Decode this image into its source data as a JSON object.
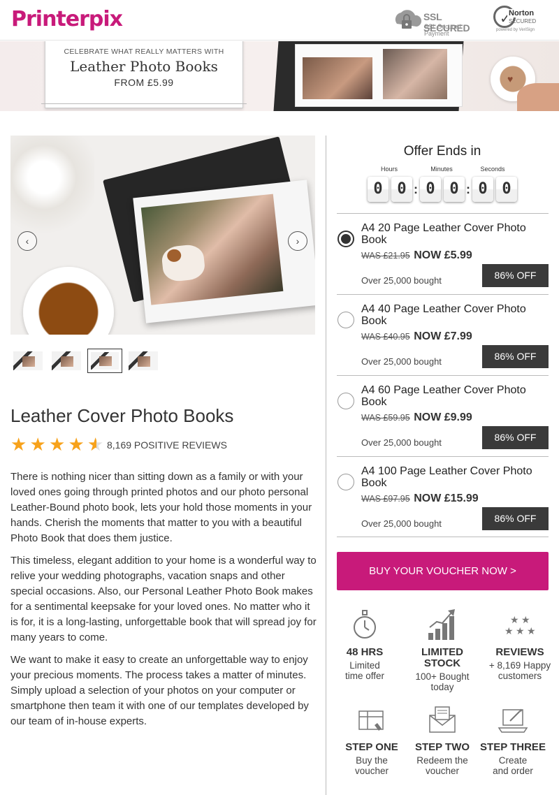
{
  "header": {
    "logo_part1": "Printer",
    "logo_part2": "pix",
    "ssl_title": "SSL SECURED",
    "ssl_subtitle": "SSL Secured Payment",
    "norton_name": "Norton",
    "norton_secured": "SECURED",
    "norton_powered": "powered by VeriSign"
  },
  "banner": {
    "line1": "CELEBRATE WHAT REALLY MATTERS WITH",
    "line2": "Leather Photo Books",
    "line3": "FROM £5.99"
  },
  "product": {
    "title": "Leather Cover Photo Books",
    "rating": 4.5,
    "reviews_text": "8,169 POSITIVE REVIEWS",
    "active_thumbnail": 3,
    "description": [
      "There is nothing nicer than sitting down as a family or with your loved ones going through printed photos and our photo personal Leather-Bound photo book, lets your hold those moments in your hands. Cherish the moments that matter to you with a beautiful Photo Book that does them justice.",
      "This timeless, elegant addition to your home is a wonderful way to relive your wedding photographs, vacation snaps and other special occasions. Also, our Personal Leather Photo Book makes for a sentimental keepsake for your loved ones. No matter who it is for, it is a long-lasting, unforgettable book that will spread joy for many years to come.",
      "We want to make it easy to create an unforgettable way to enjoy your precious moments. The process takes a matter of minutes. Simply upload a selection of your photos on your computer or smartphone then team it with one of our templates developed by our team of in-house experts."
    ]
  },
  "countdown": {
    "title": "Offer Ends in",
    "hours_label": "Hours",
    "minutes_label": "Minutes",
    "seconds_label": "Seconds",
    "hours": [
      "0",
      "0"
    ],
    "minutes": [
      "0",
      "0"
    ],
    "seconds": [
      "0",
      "0"
    ]
  },
  "options": [
    {
      "name": "A4 20 Page Leather Cover Photo Book",
      "was": "WAS £21.95",
      "now": "NOW £5.99",
      "bought": "Over 25,000 bought",
      "off": "86% OFF",
      "selected": true
    },
    {
      "name": "A4 40 Page Leather Cover Photo Book",
      "was": "WAS £40.95",
      "now": "NOW £7.99",
      "bought": "Over 25,000 bought",
      "off": "86% OFF",
      "selected": false
    },
    {
      "name": "A4 60 Page Leather Cover Photo Book",
      "was": "WAS £59.95",
      "now": "NOW £9.99",
      "bought": "Over 25,000 bought",
      "off": "86% OFF",
      "selected": false
    },
    {
      "name": "A4 100 Page Leather Cover Photo Book",
      "was": "WAS £97.95",
      "now": "NOW £15.99",
      "bought": "Over 25,000 bought",
      "off": "86% OFF",
      "selected": false
    }
  ],
  "buy_button": "BUY YOUR VOUCHER NOW >",
  "features": [
    {
      "icon": "stopwatch-icon",
      "title": "48 HRS",
      "sub": [
        "Limited",
        "time offer"
      ]
    },
    {
      "icon": "bar-chart-icon",
      "title": "LIMITED STOCK",
      "sub": [
        "100+ Bought",
        "today"
      ]
    },
    {
      "icon": "stars-icon",
      "title": "REVIEWS",
      "sub": [
        "+ 8,169 Happy",
        "customers"
      ]
    }
  ],
  "steps": [
    {
      "icon": "voucher-icon",
      "title": "STEP ONE",
      "sub": [
        "Buy the",
        "voucher"
      ]
    },
    {
      "icon": "envelope-icon",
      "title": "STEP TWO",
      "sub": [
        "Redeem the",
        "voucher"
      ]
    },
    {
      "icon": "laptop-icon",
      "title": "STEP THREE",
      "sub": [
        "Create",
        "and order"
      ]
    }
  ],
  "colors": {
    "brand": "#c81a7a",
    "star": "#f7a21b",
    "off_badge": "#3a3a3a"
  }
}
